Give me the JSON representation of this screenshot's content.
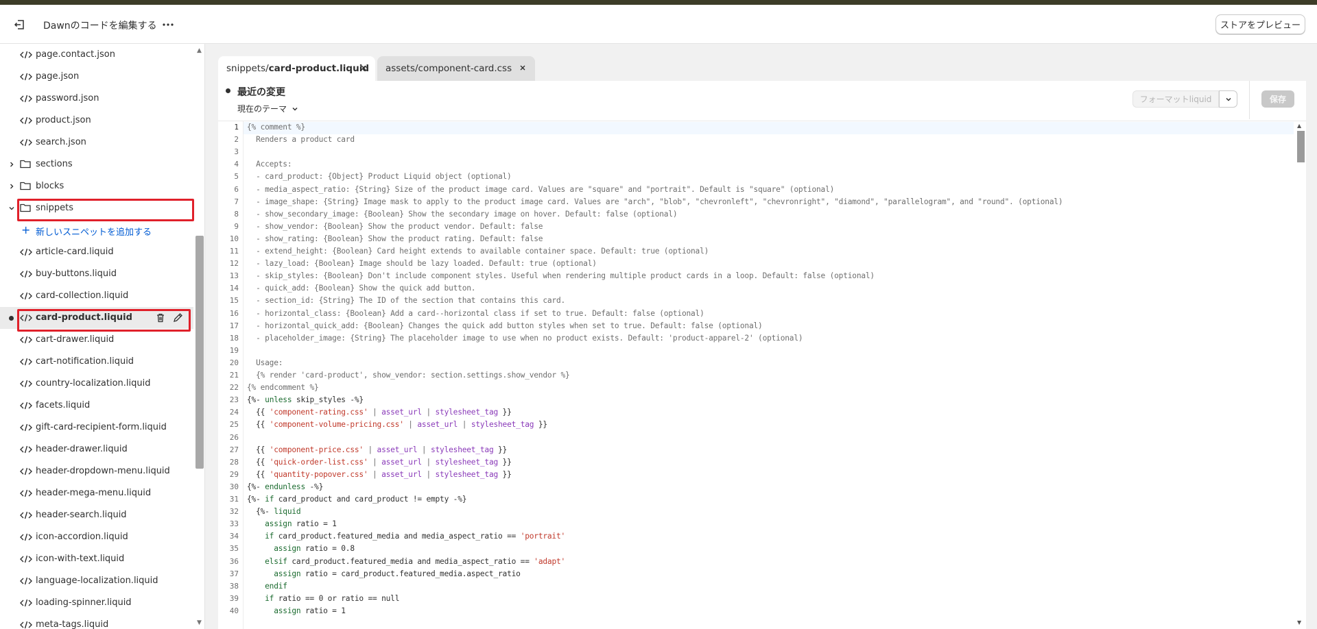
{
  "header": {
    "title": "Dawnのコードを編集する",
    "preview_label": "ストアをプレビュー"
  },
  "sidebar": {
    "items": [
      {
        "kind": "file",
        "label": "page.contact.json"
      },
      {
        "kind": "file",
        "label": "page.json"
      },
      {
        "kind": "file",
        "label": "password.json"
      },
      {
        "kind": "file",
        "label": "product.json"
      },
      {
        "kind": "file",
        "label": "search.json"
      },
      {
        "kind": "folder-collapsed",
        "label": "sections"
      },
      {
        "kind": "folder-collapsed",
        "label": "blocks"
      },
      {
        "kind": "folder-open",
        "label": "snippets",
        "highlighted": true
      },
      {
        "kind": "add",
        "label": "新しいスニペットを追加する"
      },
      {
        "kind": "file",
        "label": "article-card.liquid"
      },
      {
        "kind": "file",
        "label": "buy-buttons.liquid"
      },
      {
        "kind": "file",
        "label": "card-collection.liquid"
      },
      {
        "kind": "file",
        "label": "card-product.liquid",
        "selected": true,
        "highlighted": true,
        "modified": true
      },
      {
        "kind": "file",
        "label": "cart-drawer.liquid"
      },
      {
        "kind": "file",
        "label": "cart-notification.liquid"
      },
      {
        "kind": "file",
        "label": "country-localization.liquid"
      },
      {
        "kind": "file",
        "label": "facets.liquid"
      },
      {
        "kind": "file",
        "label": "gift-card-recipient-form.liquid"
      },
      {
        "kind": "file",
        "label": "header-drawer.liquid"
      },
      {
        "kind": "file",
        "label": "header-dropdown-menu.liquid"
      },
      {
        "kind": "file",
        "label": "header-mega-menu.liquid"
      },
      {
        "kind": "file",
        "label": "header-search.liquid"
      },
      {
        "kind": "file",
        "label": "icon-accordion.liquid"
      },
      {
        "kind": "file",
        "label": "icon-with-text.liquid"
      },
      {
        "kind": "file",
        "label": "language-localization.liquid"
      },
      {
        "kind": "file",
        "label": "loading-spinner.liquid"
      },
      {
        "kind": "file",
        "label": "meta-tags.liquid"
      }
    ]
  },
  "tabs": [
    {
      "prefix": "snippets/",
      "name": "card-product.liquid",
      "active": true
    },
    {
      "prefix": "",
      "name": "assets/component-card.css",
      "active": false
    }
  ],
  "editor": {
    "changes_title": "最近の変更",
    "theme_select": "現在のテーマ",
    "format_label": "フォーマットliquid",
    "save_label": "保存",
    "current_line": 1,
    "lines": [
      [
        [
          "cm",
          "{% comment %}"
        ]
      ],
      [
        [
          "cm",
          "  Renders a product card"
        ]
      ],
      [
        [
          "cm",
          ""
        ]
      ],
      [
        [
          "cm",
          "  Accepts:"
        ]
      ],
      [
        [
          "cm",
          "  - card_product: {Object} Product Liquid object (optional)"
        ]
      ],
      [
        [
          "cm",
          "  - media_aspect_ratio: {String} Size of the product image card. Values are \"square\" and \"portrait\". Default is \"square\" (optional)"
        ]
      ],
      [
        [
          "cm",
          "  - image_shape: {String} Image mask to apply to the product image card. Values are \"arch\", \"blob\", \"chevronleft\", \"chevronright\", \"diamond\", \"parallelogram\", and \"round\". (optional)"
        ]
      ],
      [
        [
          "cm",
          "  - show_secondary_image: {Boolean} Show the secondary image on hover. Default: false (optional)"
        ]
      ],
      [
        [
          "cm",
          "  - show_vendor: {Boolean} Show the product vendor. Default: false"
        ]
      ],
      [
        [
          "cm",
          "  - show_rating: {Boolean} Show the product rating. Default: false"
        ]
      ],
      [
        [
          "cm",
          "  - extend_height: {Boolean} Card height extends to available container space. Default: true (optional)"
        ]
      ],
      [
        [
          "cm",
          "  - lazy_load: {Boolean} Image should be lazy loaded. Default: true (optional)"
        ]
      ],
      [
        [
          "cm",
          "  - skip_styles: {Boolean} Don't include component styles. Useful when rendering multiple product cards in a loop. Default: false (optional)"
        ]
      ],
      [
        [
          "cm",
          "  - quick_add: {Boolean} Show the quick add button."
        ]
      ],
      [
        [
          "cm",
          "  - section_id: {String} The ID of the section that contains this card."
        ]
      ],
      [
        [
          "cm",
          "  - horizontal_class: {Boolean} Add a card--horizontal class if set to true. Default: false (optional)"
        ]
      ],
      [
        [
          "cm",
          "  - horizontal_quick_add: {Boolean} Changes the quick add button styles when set to true. Default: false (optional)"
        ]
      ],
      [
        [
          "cm",
          "  - placeholder_image: {String} The placeholder image to use when no product exists. Default: 'product-apparel-2' (optional)"
        ]
      ],
      [
        [
          "cm",
          ""
        ]
      ],
      [
        [
          "cm",
          "  Usage:"
        ]
      ],
      [
        [
          "cm",
          "  {% render 'card-product', show_vendor: section.settings.show_vendor %}"
        ]
      ],
      [
        [
          "cm",
          "{% endcomment %}"
        ]
      ],
      [
        [
          "pun",
          "{%- "
        ],
        [
          "kw",
          "unless"
        ],
        [
          "id",
          " skip_styles "
        ],
        [
          "pun",
          "-%}"
        ]
      ],
      [
        [
          "pun",
          "  {{ "
        ],
        [
          "str",
          "'component-rating.css'"
        ],
        [
          "cm",
          " | "
        ],
        [
          "fl",
          "asset_url"
        ],
        [
          "cm",
          " | "
        ],
        [
          "fl",
          "stylesheet_tag"
        ],
        [
          "pun",
          " }}"
        ]
      ],
      [
        [
          "pun",
          "  {{ "
        ],
        [
          "str",
          "'component-volume-pricing.css'"
        ],
        [
          "cm",
          " | "
        ],
        [
          "fl",
          "asset_url"
        ],
        [
          "cm",
          " | "
        ],
        [
          "fl",
          "stylesheet_tag"
        ],
        [
          "pun",
          " }}"
        ]
      ],
      [
        [
          "pun",
          ""
        ]
      ],
      [
        [
          "pun",
          "  {{ "
        ],
        [
          "str",
          "'component-price.css'"
        ],
        [
          "cm",
          " | "
        ],
        [
          "fl",
          "asset_url"
        ],
        [
          "cm",
          " | "
        ],
        [
          "fl",
          "stylesheet_tag"
        ],
        [
          "pun",
          " }}"
        ]
      ],
      [
        [
          "pun",
          "  {{ "
        ],
        [
          "str",
          "'quick-order-list.css'"
        ],
        [
          "cm",
          " | "
        ],
        [
          "fl",
          "asset_url"
        ],
        [
          "cm",
          " | "
        ],
        [
          "fl",
          "stylesheet_tag"
        ],
        [
          "pun",
          " }}"
        ]
      ],
      [
        [
          "pun",
          "  {{ "
        ],
        [
          "str",
          "'quantity-popover.css'"
        ],
        [
          "cm",
          " | "
        ],
        [
          "fl",
          "asset_url"
        ],
        [
          "cm",
          " | "
        ],
        [
          "fl",
          "stylesheet_tag"
        ],
        [
          "pun",
          " }}"
        ]
      ],
      [
        [
          "pun",
          "{%- "
        ],
        [
          "kw",
          "endunless"
        ],
        [
          "pun",
          " -%}"
        ]
      ],
      [
        [
          "pun",
          "{%- "
        ],
        [
          "kw",
          "if"
        ],
        [
          "id",
          " card_product "
        ],
        [
          "pun",
          "and"
        ],
        [
          "id",
          " card_product "
        ],
        [
          "pun",
          "!= empty -%}"
        ]
      ],
      [
        [
          "pun",
          "  {%- "
        ],
        [
          "kw",
          "liquid"
        ]
      ],
      [
        [
          "kw",
          "    assign"
        ],
        [
          "id",
          " ratio = 1"
        ]
      ],
      [
        [
          "kw",
          "    if"
        ],
        [
          "id",
          " card_product.featured_media "
        ],
        [
          "pun",
          "and"
        ],
        [
          "id",
          " media_aspect_ratio == "
        ],
        [
          "str",
          "'portrait'"
        ]
      ],
      [
        [
          "kw",
          "      assign"
        ],
        [
          "id",
          " ratio = 0.8"
        ]
      ],
      [
        [
          "kw",
          "    elsif"
        ],
        [
          "id",
          " card_product.featured_media "
        ],
        [
          "pun",
          "and"
        ],
        [
          "id",
          " media_aspect_ratio == "
        ],
        [
          "str",
          "'adapt'"
        ]
      ],
      [
        [
          "kw",
          "      assign"
        ],
        [
          "id",
          " ratio = card_product.featured_media.aspect_ratio"
        ]
      ],
      [
        [
          "kw",
          "    endif"
        ]
      ],
      [
        [
          "kw",
          "    if"
        ],
        [
          "id",
          " ratio == 0 "
        ],
        [
          "pun",
          "or"
        ],
        [
          "id",
          " ratio == null"
        ]
      ],
      [
        [
          "kw",
          "      assign"
        ],
        [
          "id",
          " ratio = 1"
        ]
      ]
    ]
  }
}
